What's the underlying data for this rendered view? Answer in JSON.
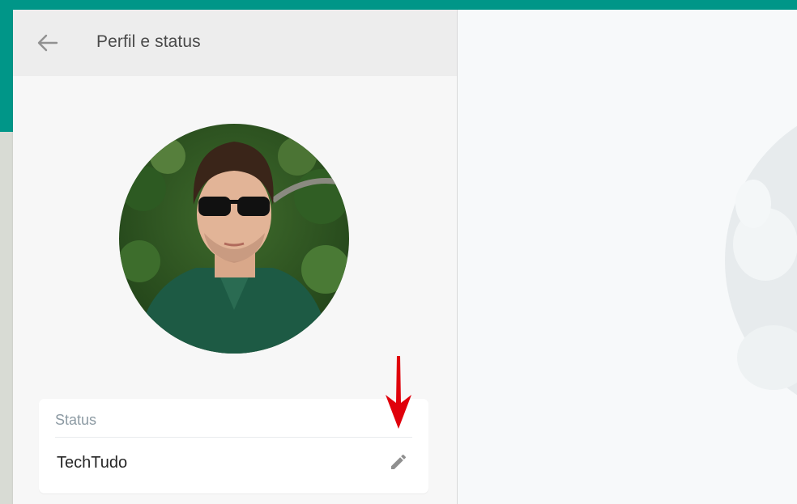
{
  "header": {
    "title": "Perfil e status",
    "back_icon": "arrow-left-icon"
  },
  "profile": {
    "avatar_description": "profile-photo"
  },
  "status": {
    "label": "Status",
    "value": "TechTudo",
    "edit_icon": "pencil-icon"
  },
  "annotation": {
    "arrow_icon": "red-down-arrow-icon",
    "color": "#e0000b"
  },
  "colors": {
    "accent": "#009688",
    "header_bg": "#ededed",
    "drawer_bg": "#f7f7f7"
  }
}
